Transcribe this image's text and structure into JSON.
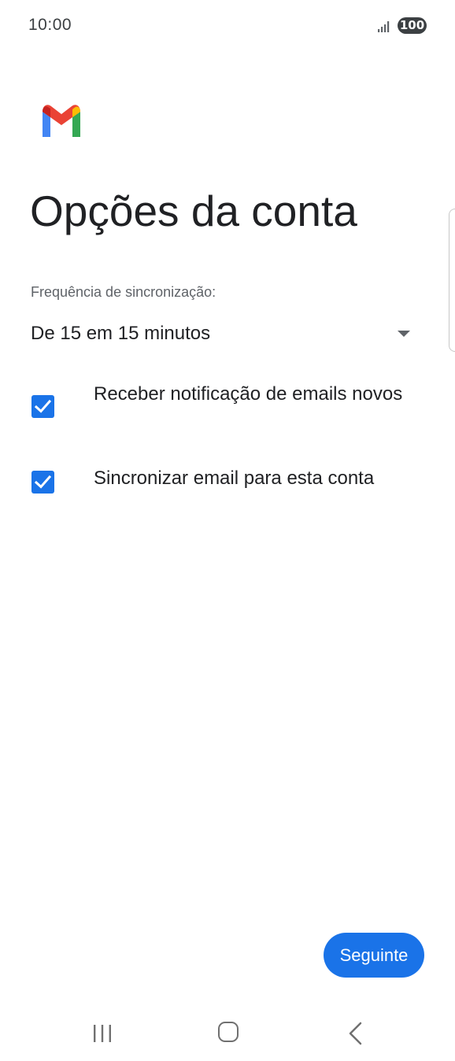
{
  "status_bar": {
    "time": "10:00",
    "battery": "100"
  },
  "page": {
    "title": "Opções da conta"
  },
  "sync_frequency": {
    "label": "Frequência de sincronização:",
    "selected": "De 15 em 15 minutos"
  },
  "options": [
    {
      "label": "Receber notificação de emails novos",
      "checked": true
    },
    {
      "label": "Sincronizar email para esta conta",
      "checked": true
    }
  ],
  "actions": {
    "next_label": "Seguinte"
  },
  "colors": {
    "accent": "#1a73e8",
    "gmail_red": "#ea4335",
    "gmail_blue": "#4285f4",
    "gmail_green": "#34a853",
    "gmail_yellow": "#fbbc04"
  },
  "icons": {
    "app": "gmail-icon",
    "signal": "signal-icon",
    "battery": "battery-icon",
    "dropdown": "chevron-down-icon",
    "check": "check-icon",
    "nav_recents": "recents-icon",
    "nav_home": "home-icon",
    "nav_back": "back-icon"
  }
}
